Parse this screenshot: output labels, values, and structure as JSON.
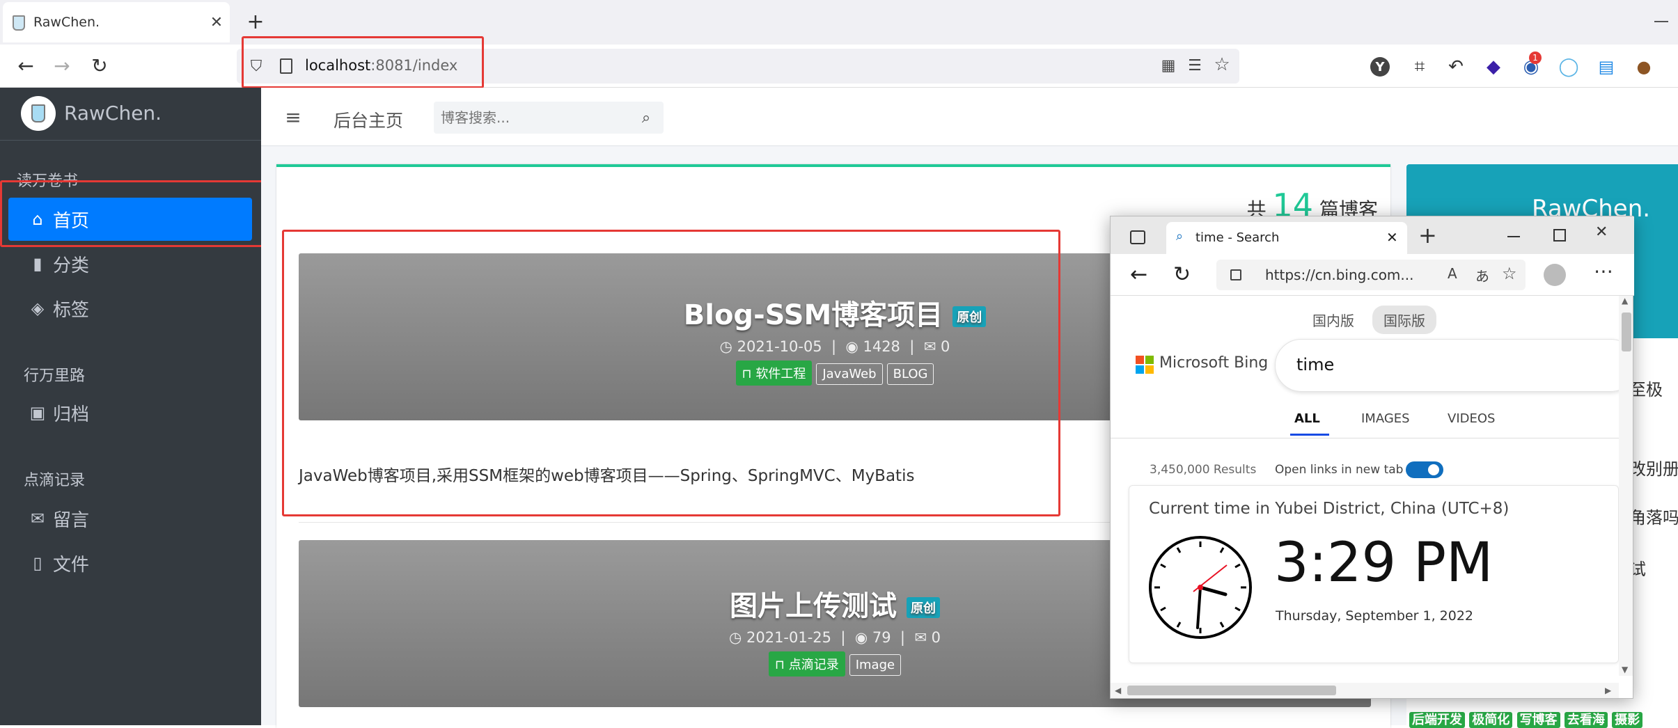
{
  "browser": {
    "tab_title": "RawChen.",
    "url_host": "localhost",
    "url_rest": ":8081/index",
    "ext_badge": "1"
  },
  "sidebar": {
    "brand": "RawChen.",
    "sections": [
      {
        "label": "读万卷书"
      },
      {
        "label": "行万里路"
      },
      {
        "label": "点滴记录"
      }
    ],
    "items": [
      {
        "label": "首页"
      },
      {
        "label": "分类"
      },
      {
        "label": "标签"
      },
      {
        "label": "归档"
      },
      {
        "label": "留言"
      },
      {
        "label": "文件"
      }
    ]
  },
  "topnav": {
    "home_link": "后台主页",
    "search_placeholder": "博客搜索..."
  },
  "main": {
    "count_prefix": "共",
    "count_value": "14",
    "count_suffix": "篇博客",
    "posts": [
      {
        "title": "Blog-SSM博客项目",
        "badge": "原创",
        "date": "2021-10-05",
        "views": "1428",
        "comments": "0",
        "tags": [
          "软件工程",
          "JavaWeb",
          "BLOG"
        ],
        "summary": "JavaWeb博客项目,采用SSM框架的web博客项目——Spring、SpringMVC、MyBatis"
      },
      {
        "title": "图片上传测试",
        "badge": "原创",
        "date": "2021-01-25",
        "views": "79",
        "comments": "0",
        "tags": [
          "点滴记录",
          "Image"
        ]
      }
    ]
  },
  "right_panel": {
    "title": "RawChen.",
    "snippets": [
      "至极",
      "改别册",
      "角落吗",
      "试"
    ],
    "tags": [
      "后端开发",
      "极简化",
      "写博客",
      "去看海",
      "摄影"
    ]
  },
  "edge": {
    "tab_title": "time - Search",
    "url": "https://cn.bing.com...",
    "region_tabs": [
      "国内版",
      "国际版"
    ],
    "brand": "Microsoft Bing",
    "query": "time",
    "nav": [
      "ALL",
      "IMAGES",
      "VIDEOS"
    ],
    "results_count": "3,450,000 Results",
    "open_links": "Open links in new tab",
    "time_heading": "Current time in Yubei District, China (UTC+8)",
    "time": "3:29 PM",
    "date": "Thursday, September 1, 2022",
    "colors": {
      "accent": "#0f6cbd",
      "toggle": "#106ebe"
    }
  }
}
